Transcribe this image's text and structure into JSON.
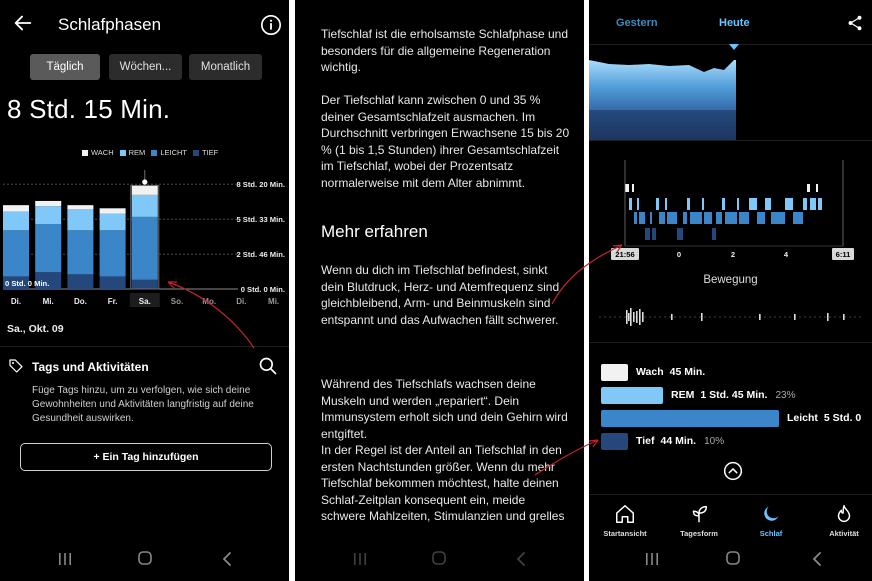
{
  "panel1": {
    "title": "Schlafphasen",
    "segments": [
      "Täglich",
      "Wöchen...",
      "Monatlich"
    ],
    "active_segment": 0,
    "duration": "8 Std. 15 Min.",
    "legend": [
      {
        "label": "WACH",
        "color": "#f2f2f2"
      },
      {
        "label": "REM",
        "color": "#7fc8f8"
      },
      {
        "label": "LEICHT",
        "color": "#3a86c8"
      },
      {
        "label": "TIEF",
        "color": "#24487c"
      }
    ],
    "date": "Sa., Okt. 09",
    "tags_title": "Tags und Aktivitäten",
    "tags_desc": "Füge Tags hinzu, um zu verfolgen, wie sich deine Gewohnheiten und Aktivitäten langfristig auf deine Gesundheit auswirken.",
    "add_tag": "+ Ein Tag hinzufügen",
    "chart_data": {
      "type": "bar",
      "stacked": true,
      "categories": [
        "Di.",
        "Mi.",
        "Do.",
        "Fr.",
        "Sa.",
        "So.",
        "Mo.",
        "Di.",
        "Mi."
      ],
      "y_tick_labels": [
        "0 Std. 0 Min.",
        "2 Std. 46 Min.",
        "5 Std. 33 Min.",
        "8 Std. 20 Min."
      ],
      "y_ticks_minutes": [
        0,
        166,
        333,
        500
      ],
      "inline_label": "0 Std. 0 Min.",
      "ylim_minutes": [
        0,
        520
      ],
      "series": [
        {
          "name": "TIEF",
          "values": [
            60,
            80,
            70,
            60,
            44,
            0,
            0,
            0,
            0
          ],
          "color": "#24487c"
        },
        {
          "name": "LEICHT",
          "values": [
            220,
            230,
            210,
            220,
            300,
            0,
            0,
            0,
            0
          ],
          "color": "#3a86c8"
        },
        {
          "name": "REM",
          "values": [
            90,
            85,
            100,
            80,
            105,
            0,
            0,
            0,
            0
          ],
          "color": "#7fc8f8"
        },
        {
          "name": "WACH",
          "values": [
            30,
            25,
            20,
            25,
            45,
            0,
            0,
            0,
            0
          ],
          "color": "#f2f2f2"
        }
      ],
      "selected_category": 4
    }
  },
  "panel2": {
    "para1": "Tiefschlaf ist die erholsamste Schlafphase und besonders für die allgemeine Regeneration wichtig.",
    "para2": "Der Tiefschlaf kann zwischen 0 und 35 % deiner Gesamtschlafzeit ausmachen. Im Durchschnitt verbringen Erwachsene 15 bis 20 % (1 bis 1,5 Stunden) ihrer Gesamtschlafzeit im Tiefschlaf, wobei der Prozentsatz normalerweise mit dem Alter abnimmt.",
    "heading": "Mehr erfahren",
    "para3": "Wenn du dich im Tiefschlaf befindest, sinkt dein Blutdruck, Herz- und Atemfrequenz sind gleichbleibend, Arm- und Beinmuskeln sind entspannt und das Aufwachen fällt schwerer.",
    "para4": "Während des Tiefschlafs wachsen deine Muskeln und werden „repariert“. Dein Immunsystem erholt sich und dein Gehirn wird entgiftet.",
    "para5": "In der Regel ist der Anteil an Tiefschlaf in den ersten Nachtstunden größer. Wenn du mehr Tiefschlaf bekommen möchtest, halte deinen Schlaf-Zeitplan konsequent ein, meide schwere Mahlzeiten, Stimulanzien und grelles"
  },
  "panel3": {
    "tab_prev": "Gestern",
    "tab_active": "Heute",
    "hypnogram_start": "21:56",
    "hypnogram_end": "6:11",
    "hypnogram_ticks": [
      "0",
      "2",
      "4"
    ],
    "movement_title": "Bewegung",
    "stages": [
      {
        "name": "Wach",
        "duration": "45 Min.",
        "pct": "",
        "color": "#f2f2f2"
      },
      {
        "name": "REM",
        "duration": "1 Std. 45 Min.",
        "pct": "23%",
        "color": "#7fc8f8"
      },
      {
        "name": "Leicht",
        "duration": "5 Std. 0",
        "pct": "",
        "color": "#3a86c8"
      },
      {
        "name": "Tief",
        "duration": "44 Min.",
        "pct": "10%",
        "color": "#24487c"
      }
    ],
    "nav": [
      {
        "label": "Startansicht",
        "icon": "home-icon"
      },
      {
        "label": "Tagesform",
        "icon": "sprout-icon"
      },
      {
        "label": "Schlaf",
        "icon": "moon-icon"
      },
      {
        "label": "Aktivität",
        "icon": "flame-icon"
      }
    ]
  },
  "colors": {
    "wach": "#f2f2f2",
    "rem": "#7fc8f8",
    "leicht": "#3a86c8",
    "tief": "#24487c",
    "accent": "#6cc4ff",
    "arrow": "#c0242c"
  }
}
